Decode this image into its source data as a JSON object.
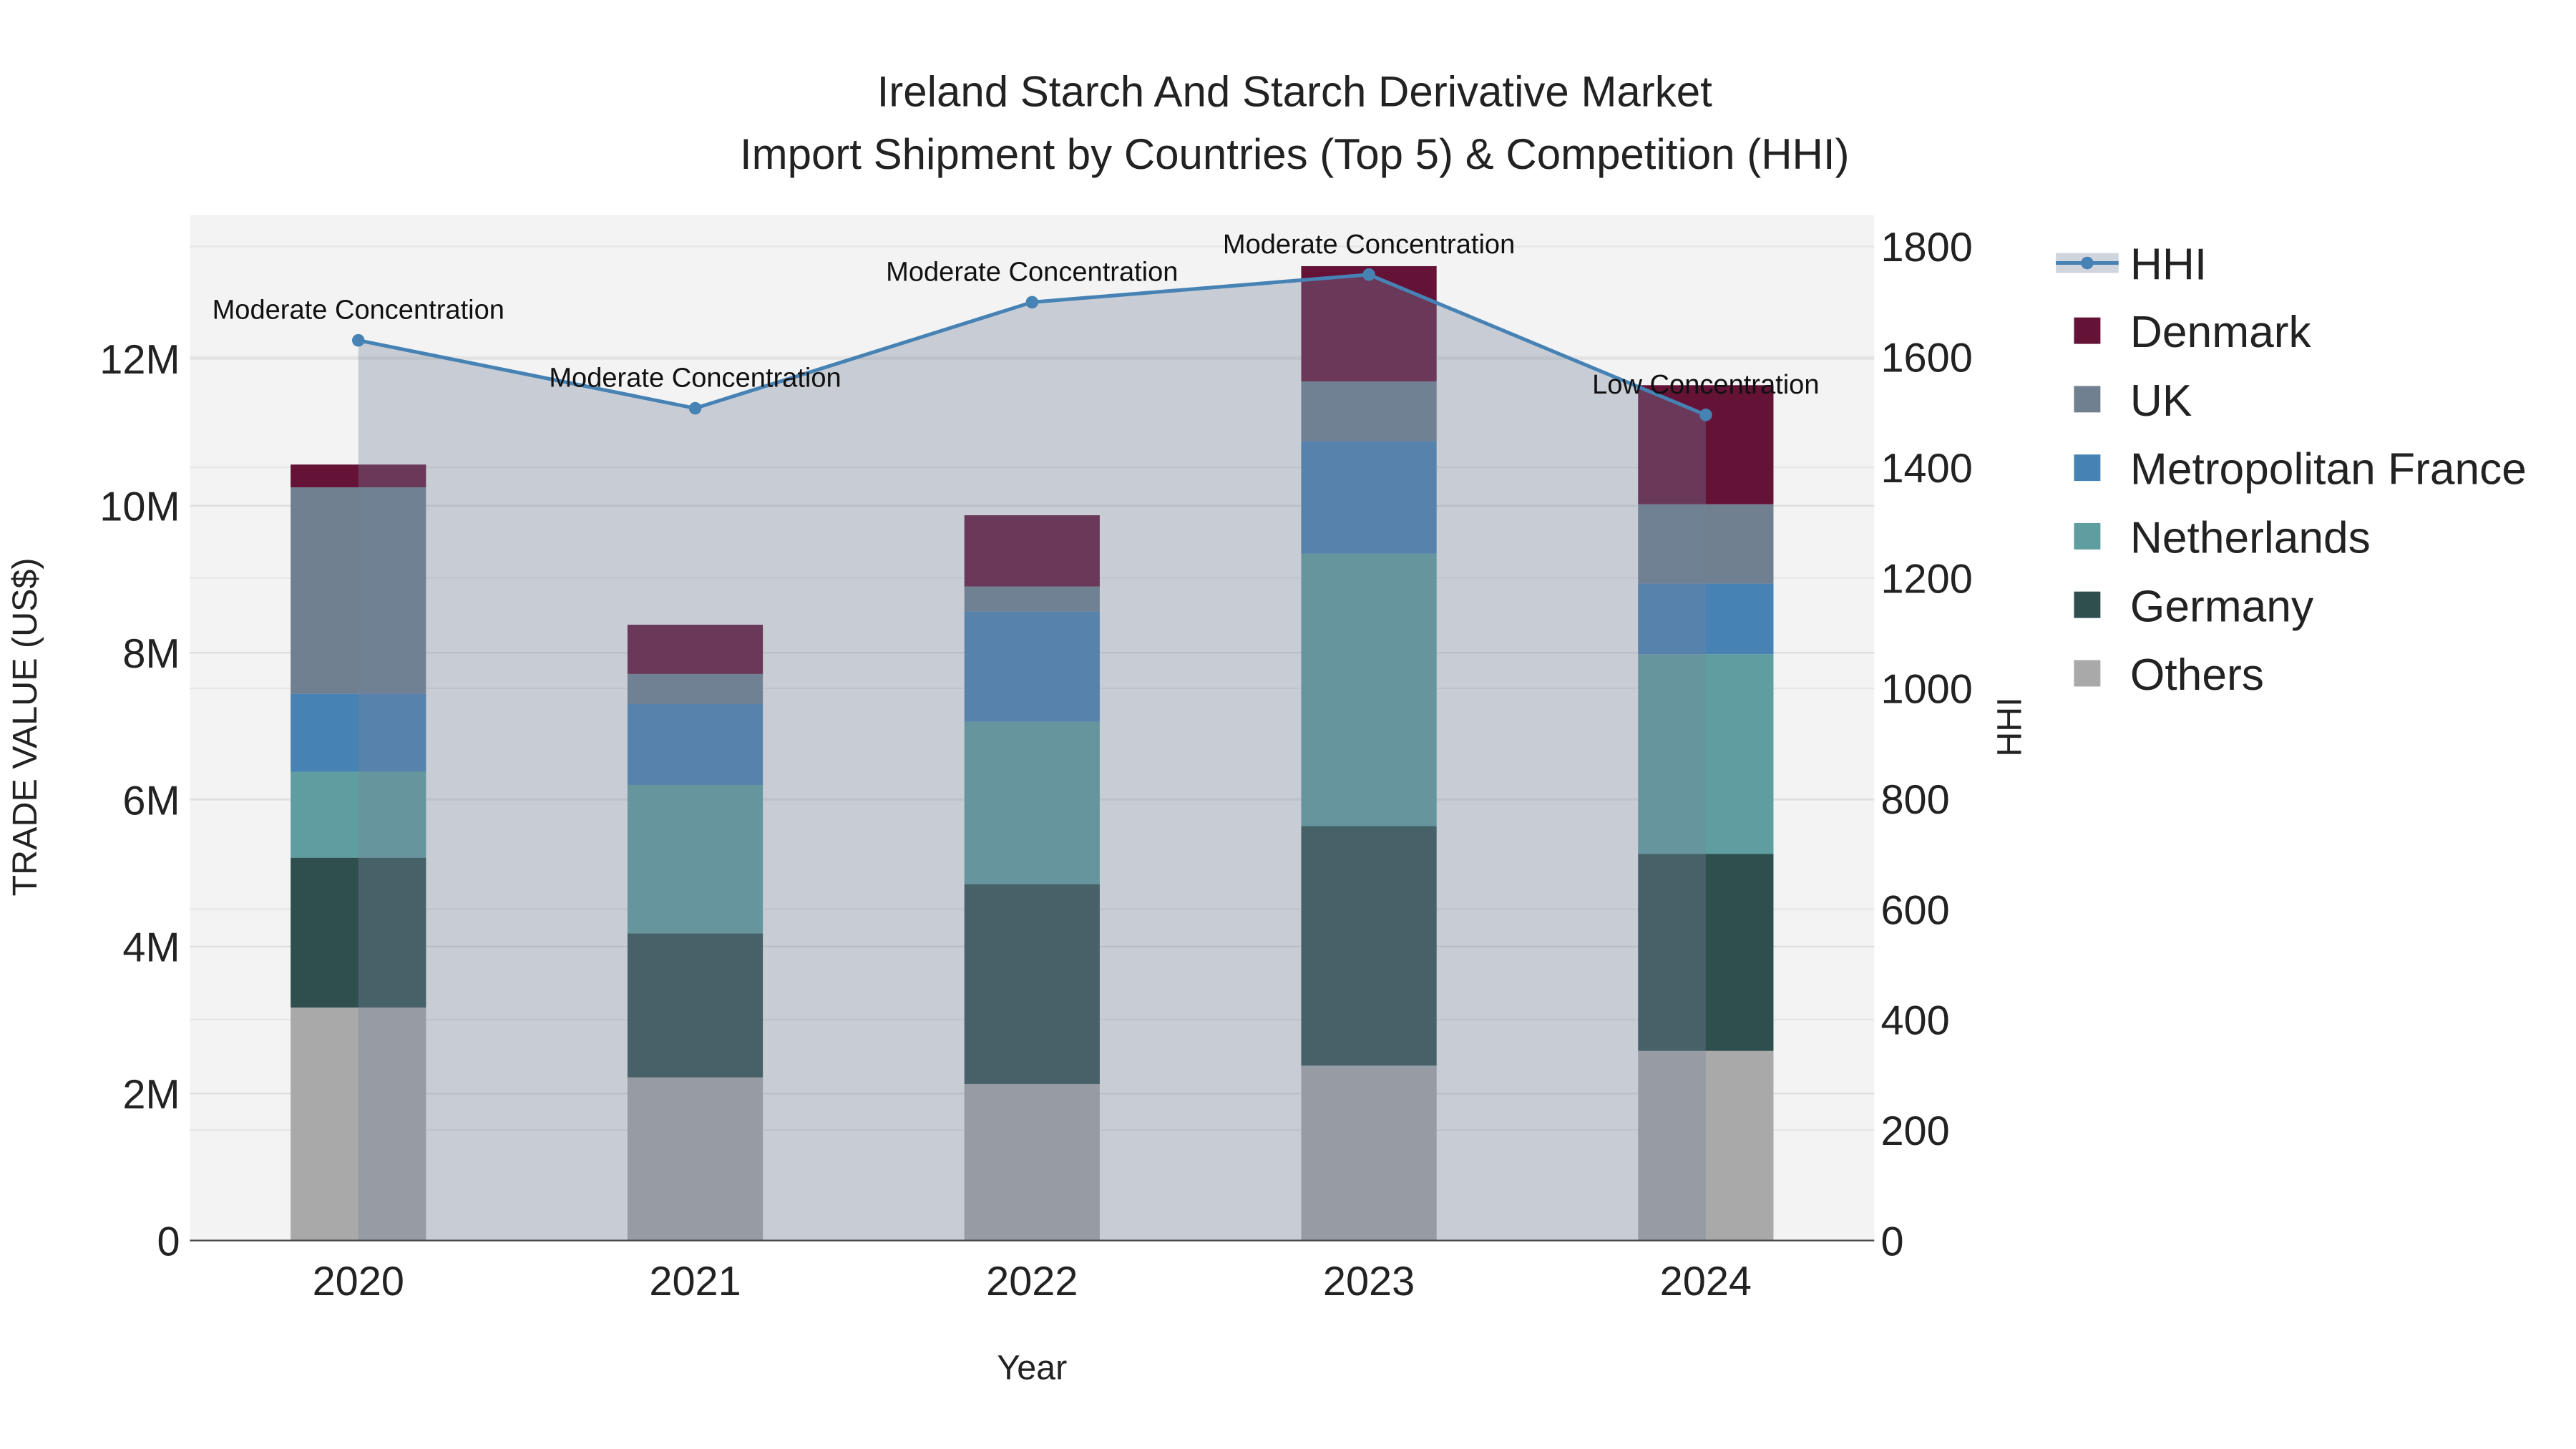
{
  "chart_data": {
    "type": "bar",
    "stacked": true,
    "title": "Ireland Starch And Starch Derivative Market",
    "subtitle": "Import Shipment by Countries (Top 5) & Competition (HHI)",
    "xlabel": "Year",
    "ylabel": "TRADE VALUE (US$)",
    "y2label": "HHI",
    "categories": [
      "2020",
      "2021",
      "2022",
      "2023",
      "2024"
    ],
    "ylim": [
      0,
      13800000
    ],
    "y2lim": [
      0,
      1850
    ],
    "yticks": [
      0,
      2000000,
      4000000,
      6000000,
      8000000,
      10000000,
      12000000
    ],
    "ytick_labels": [
      "0",
      "2M",
      "4M",
      "6M",
      "8M",
      "10M",
      "12M"
    ],
    "y2ticks": [
      0,
      200,
      400,
      600,
      800,
      1000,
      1200,
      1400,
      1600,
      1800
    ],
    "y2tick_labels": [
      "0",
      "200",
      "400",
      "600",
      "800",
      "1000",
      "1200",
      "1400",
      "1600",
      "1800"
    ],
    "series": [
      {
        "name": "Others",
        "color": "#a9a9a9",
        "values": [
          3170000,
          2220000,
          2130000,
          2380000,
          2580000
        ]
      },
      {
        "name": "Germany",
        "color": "#2f4f4f",
        "values": [
          2040000,
          1960000,
          2720000,
          3260000,
          2680000
        ]
      },
      {
        "name": "Netherlands",
        "color": "#5f9ea0",
        "values": [
          1170000,
          2020000,
          2210000,
          3710000,
          2720000
        ]
      },
      {
        "name": "Metropolitan France",
        "color": "#4682b4",
        "values": [
          1060000,
          1100000,
          1500000,
          1530000,
          960000
        ]
      },
      {
        "name": "UK",
        "color": "#708090",
        "values": [
          2810000,
          410000,
          340000,
          810000,
          1080000
        ]
      },
      {
        "name": "Denmark",
        "color": "#641236",
        "values": [
          310000,
          670000,
          970000,
          1570000,
          1620000
        ]
      }
    ],
    "hhi": {
      "name": "HHI",
      "color": "#4682b4",
      "values": [
        1630,
        1507,
        1699,
        1749,
        1495
      ],
      "annotations": [
        "Moderate Concentration",
        "Moderate Concentration",
        "Moderate Concentration",
        "Moderate Concentration",
        "Low Concentration"
      ]
    },
    "legend": {
      "placement": "right",
      "entries": [
        "HHI",
        "Denmark",
        "UK",
        "Metropolitan France",
        "Netherlands",
        "Germany",
        "Others"
      ]
    },
    "grid": true
  }
}
